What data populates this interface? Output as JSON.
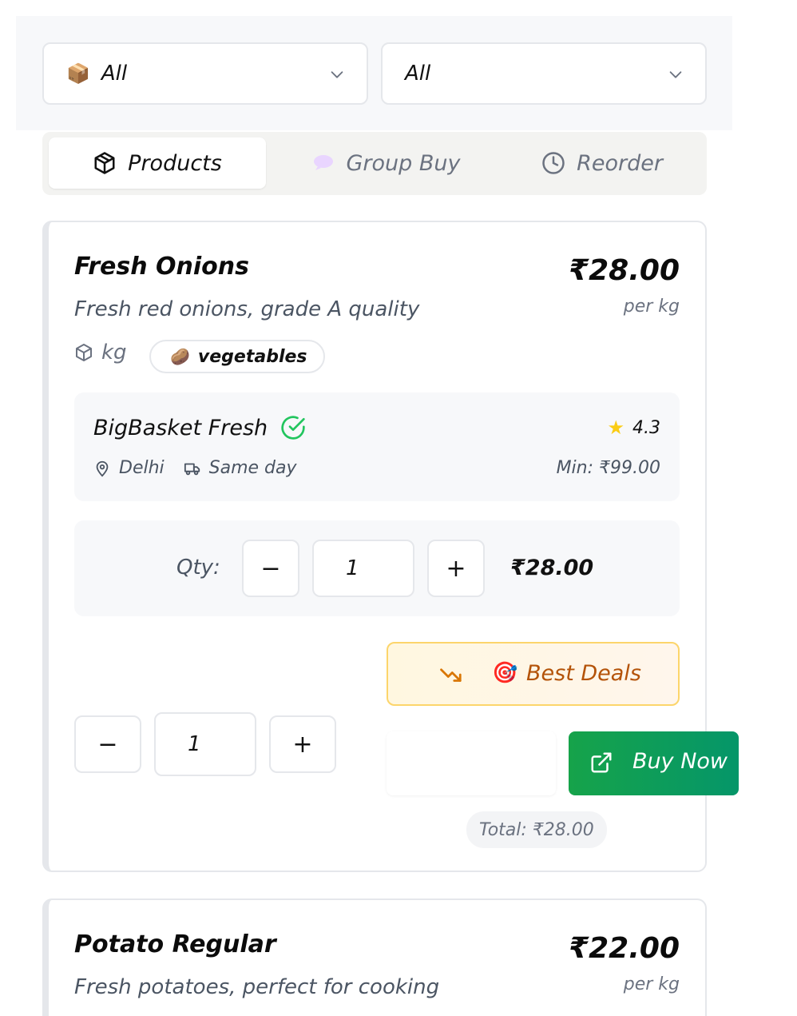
{
  "filters": {
    "first": {
      "icon": "package-emoji",
      "value": "All"
    },
    "second": {
      "value": "All"
    }
  },
  "tabs": [
    {
      "label": "Products",
      "icon": "cube-icon",
      "active": true
    },
    {
      "label": "Group Buy",
      "icon": "speech-bubble-icon",
      "active": false
    },
    {
      "label": "Reorder",
      "icon": "clock-icon",
      "active": false
    }
  ],
  "products": [
    {
      "name": "Fresh Onions",
      "description": "Fresh red onions, grade A quality",
      "price": "₹28.00",
      "per_unit": "per kg",
      "unit": "kg",
      "category": "vegetables",
      "vendor": {
        "name": "BigBasket Fresh",
        "verified": true,
        "rating": "4.3",
        "location": "Delhi",
        "delivery": "Same day",
        "min_order": "Min: ₹99.00"
      },
      "qty_label": "Qty:",
      "qty_value": "1",
      "qty_total": "₹28.00",
      "deals_label": "Best Deals",
      "second_qty_value": "1",
      "buy_label": "Buy Now",
      "total_label": "Total: ₹28.00"
    },
    {
      "name": "Potato Regular",
      "description": "Fresh potatoes, perfect for cooking",
      "price": "₹22.00",
      "per_unit": "per kg"
    }
  ],
  "colors": {
    "accent_green": "#16a34a",
    "deals_border": "#fcd56b",
    "deals_text": "#b45309",
    "star": "#facc15",
    "verified": "#22c55e"
  }
}
